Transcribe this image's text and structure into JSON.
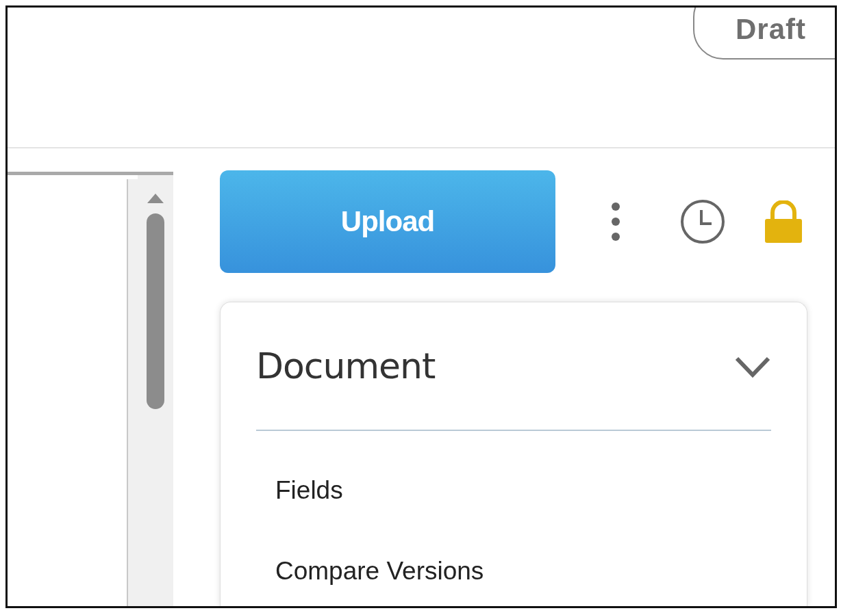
{
  "status_badge": "Draft",
  "toolbar": {
    "upload_button": "Upload"
  },
  "panel": {
    "title": "Document",
    "expanded": true,
    "items": [
      {
        "label": "Fields"
      },
      {
        "label": "Compare Versions"
      }
    ]
  }
}
